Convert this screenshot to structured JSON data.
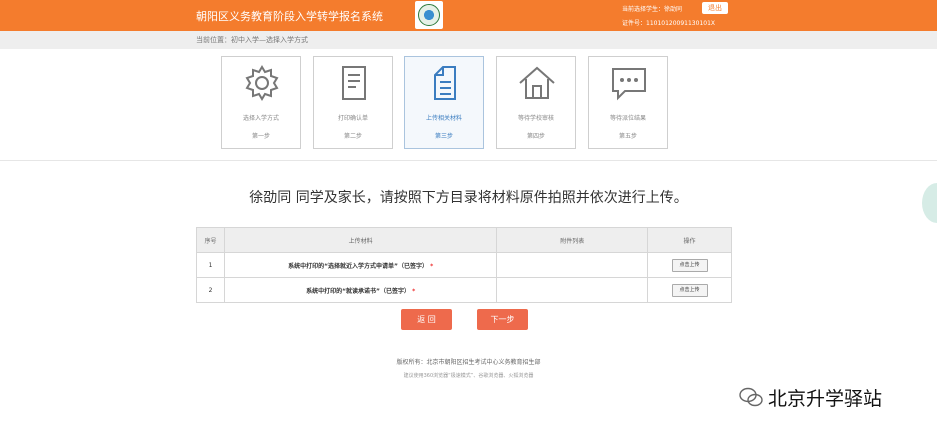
{
  "header": {
    "title": "朝阳区义务教育阶段入学转学报名系统",
    "user_line": "当前选择学生：徐劭同",
    "logout_label": "退出",
    "id_line": "证件号：110101200911301​01X",
    "accent_color": "#f47c2d"
  },
  "breadcrumb": {
    "text": "当前位置：初中入学—选择入学方式"
  },
  "steps": [
    {
      "label": "选择入学方式",
      "step": "第一步",
      "icon": "gear-icon"
    },
    {
      "label": "打印确认单",
      "step": "第二步",
      "icon": "document-icon"
    },
    {
      "label": "上传相关材料",
      "step": "第三步",
      "icon": "upload-doc-icon",
      "active": true
    },
    {
      "label": "等待学校审核",
      "step": "第四步",
      "icon": "home-icon"
    },
    {
      "label": "等待派位结果",
      "step": "第五步",
      "icon": "chat-icon"
    }
  ],
  "main": {
    "heading": "徐劭同 同学及家长，请按照下方目录将材料原件拍照并依次进行上传。"
  },
  "table": {
    "headers": [
      "序号",
      "上传材料",
      "附件列表",
      "操作"
    ],
    "rows": [
      {
        "no": "1",
        "material": "系统中打印的“选择就近入学方式申请单”（已签字）",
        "required": "*",
        "attachments": "",
        "action": "点击上传"
      },
      {
        "no": "2",
        "material": "系统中打印的“就读承诺书”（已签字）",
        "required": "*",
        "attachments": "",
        "action": "点击上传"
      }
    ]
  },
  "buttons": {
    "back": "返 回",
    "next": "下一步",
    "button_color": "#ee6a4c"
  },
  "footer": {
    "copyright": "版权所有：北京市朝阳区招生考试中心义务教育招生部",
    "browser_tip": "建议使用360浏览器“极速模式”、谷歌浏览器、火狐浏览器"
  },
  "watermark": {
    "text": "北京升学驿站"
  }
}
